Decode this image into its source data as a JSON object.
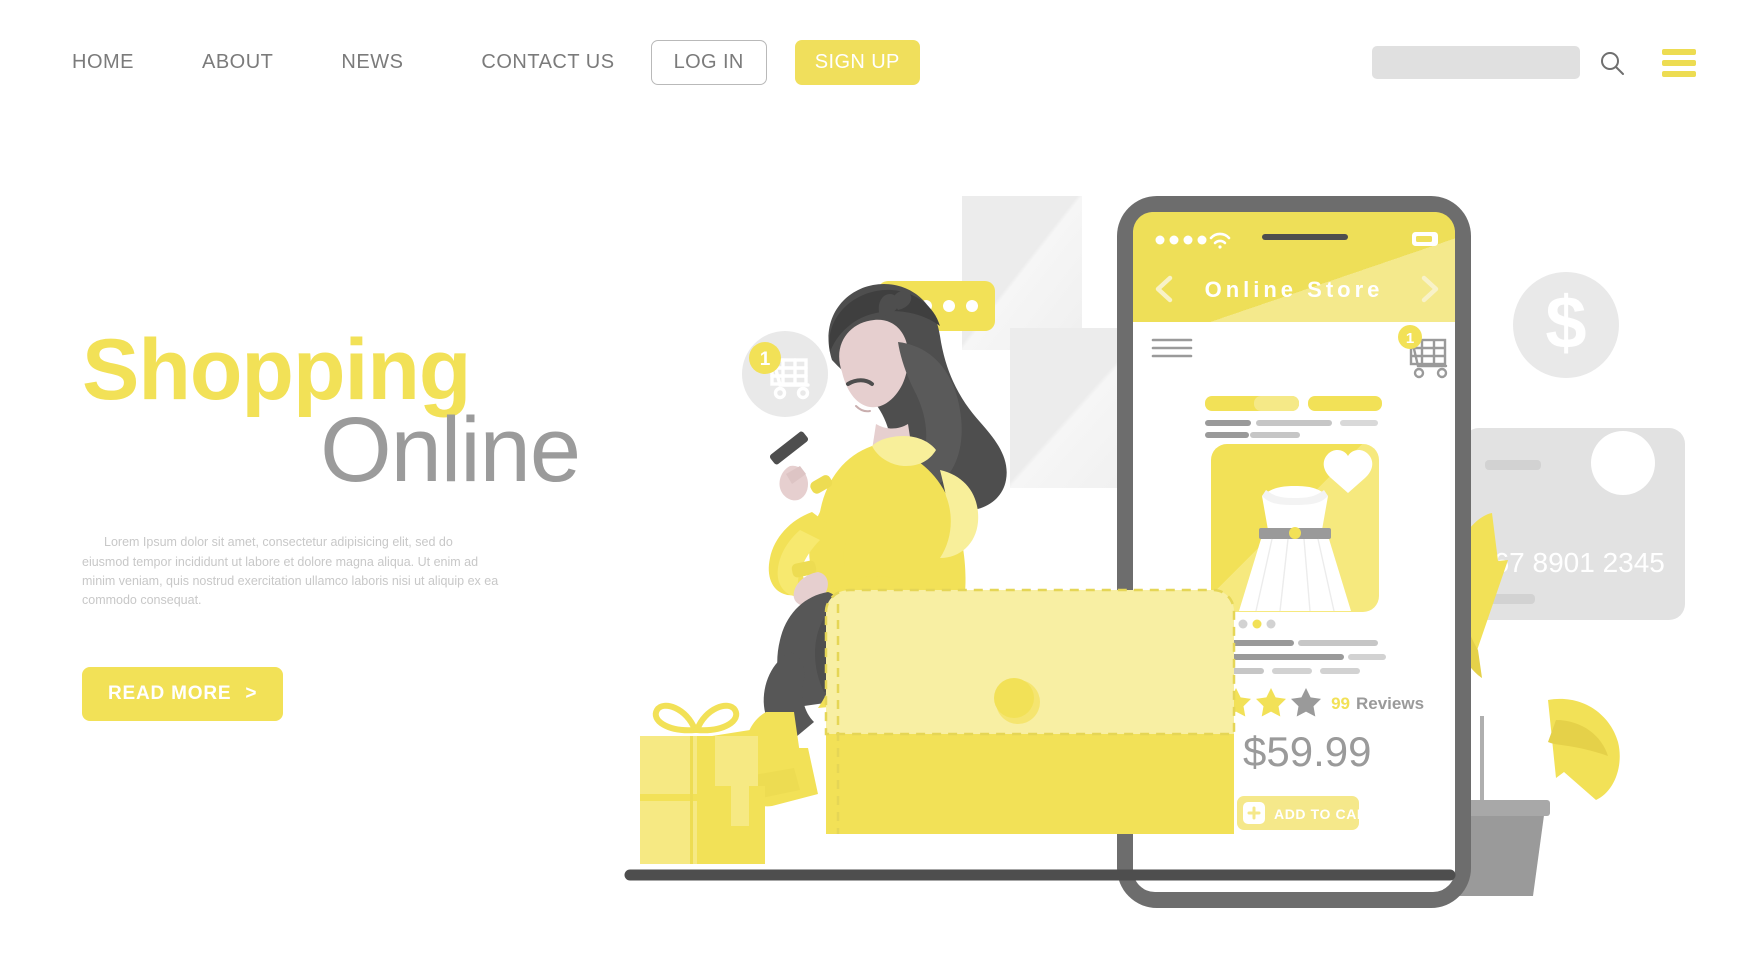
{
  "nav": {
    "links": [
      {
        "label": "HOME",
        "name": "nav-link-home"
      },
      {
        "label": "ABOUT",
        "name": "nav-link-about"
      },
      {
        "label": "NEWS",
        "name": "nav-link-news"
      },
      {
        "label": "CONTACT US",
        "name": "nav-link-contact-us"
      }
    ],
    "login_label": "LOG IN",
    "signup_label": "SIGN UP",
    "search_placeholder": "",
    "search_value": "",
    "icons": {
      "search": "search-icon",
      "menu": "hamburger-menu-icon"
    }
  },
  "hero": {
    "title_line1": "Shopping",
    "title_line2": "Online",
    "paragraph": "Lorem Ipsum dolor sit amet, consectetur adipisicing elit, sed do eiusmod tempor incididunt ut labore et dolore magna aliqua. Ut enim ad minim veniam, quis nostrud exercitation ullamco laboris nisi ut aliquip ex ea commodo consequat.",
    "cta_label": "READ MORE",
    "cta_chevron": ">"
  },
  "phone": {
    "statusbar": {
      "signal_dots": 4,
      "wifi": "wifi-icon",
      "battery": "battery-icon"
    },
    "header": {
      "title": "Online Store",
      "back": "‹",
      "forward": "›"
    },
    "toolbar": {
      "menu_icon": "hamburger-menu-icon",
      "cart_icon": "shopping-cart-icon",
      "cart_badge": "1"
    },
    "product": {
      "image_alt": "white-dress",
      "favorite_icon": "heart-icon",
      "stars_filled": 2,
      "stars_empty": 1,
      "reviews_count": "99",
      "reviews_label": "Reviews",
      "price": "$59.99",
      "add_to_cart_label": "ADD TO CART",
      "add_to_cart_icon": "plus-icon",
      "carousel_dots": 5,
      "carousel_active_index": 3
    }
  },
  "floating": {
    "cart_badge": "1",
    "cart_icon": "shopping-cart-icon",
    "chat_bubble_dots": 4,
    "coin_symbol": "$",
    "card_number": "567 8901 2345"
  },
  "colors": {
    "yellow": "#f2e157",
    "yellow_light": "#f8efa3",
    "yellow_deep": "#eddc52",
    "gray_text": "#7b7b7b",
    "gray_light": "#e0e0e0",
    "dark": "#4e4e4e",
    "heading_gray": "#9b9b9b"
  }
}
